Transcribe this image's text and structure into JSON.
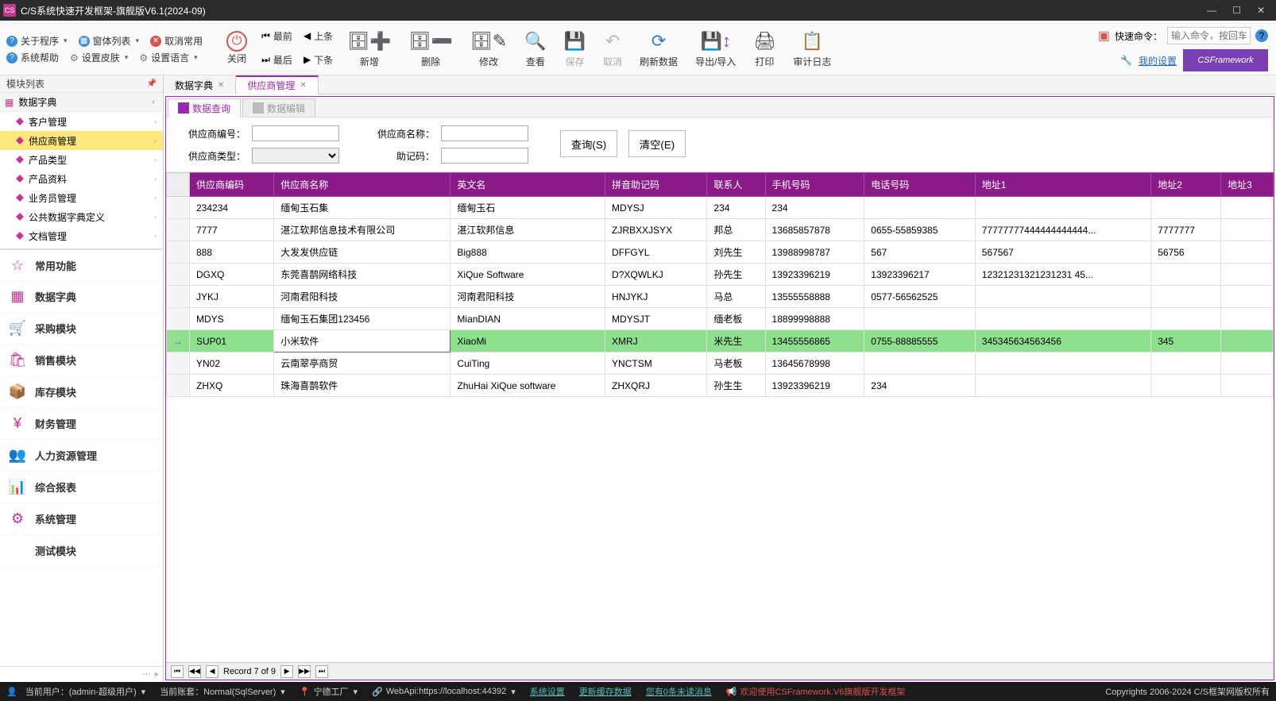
{
  "titlebar": {
    "title": "C/S系统快速开发框架-旗舰版V6.1(2024-09)"
  },
  "toolbar": {
    "about": "关于程序",
    "windowList": "窗体列表",
    "cancelCommon": "取消常用",
    "sysHelp": "系统帮助",
    "skin": "设置皮肤",
    "lang": "设置语言",
    "close": "关闭",
    "first": "最前",
    "prev": "上条",
    "last": "最后",
    "next": "下条",
    "add": "新增",
    "delete": "删除",
    "modify": "修改",
    "view": "查看",
    "save": "保存",
    "cancel": "取消",
    "refresh": "刷新数据",
    "importExport": "导出/导入",
    "print": "打印",
    "auditLog": "审计日志",
    "quickCmd": "快速命令：",
    "quickPlaceholder": "输入命令，按回车",
    "mySettings": "我的设置",
    "logoText": "CSFramework"
  },
  "sidebar": {
    "title": "模块列表",
    "treeRoot": "数据字典",
    "items": [
      "客户管理",
      "供应商管理",
      "产品类型",
      "产品资料",
      "业务员管理",
      "公共数据字典定义",
      "文档管理"
    ],
    "activeIndex": 1,
    "modules": [
      "常用功能",
      "数据字典",
      "采购模块",
      "销售模块",
      "库存模块",
      "财务管理",
      "人力资源管理",
      "综合报表",
      "系统管理",
      "测试模块"
    ]
  },
  "tabs": {
    "items": [
      "数据字典",
      "供应商管理"
    ],
    "active": 1
  },
  "subtabs": {
    "query": "数据查询",
    "edit": "数据编辑"
  },
  "form": {
    "supCode": "供应商编号：",
    "supName": "供应商名称：",
    "supType": "供应商类型：",
    "mnemonic": "助记码：",
    "search": "查询(S)",
    "clear": "清空(E)"
  },
  "grid": {
    "columns": [
      "供应商编码",
      "供应商名称",
      "英文名",
      "拼音助记码",
      "联系人",
      "手机号码",
      "电话号码",
      "地址1",
      "地址2",
      "地址3"
    ],
    "rows": [
      {
        "c": [
          "234234",
          "缅甸玉石集",
          "缅甸玉石",
          "MDYSJ",
          "234",
          "234",
          "",
          "",
          "",
          ""
        ]
      },
      {
        "c": [
          "7777",
          "湛江软邦信息技术有限公司",
          "湛江软邦信息",
          "ZJRBXXJSYX",
          "邦总",
          "13685857878",
          "0655-55859385",
          "77777777444444444444...",
          "7777777",
          ""
        ]
      },
      {
        "c": [
          "888",
          "大发发供应链",
          "Big888",
          "DFFGYL",
          "刘先生",
          "13988998787",
          "567",
          "567567",
          "56756",
          ""
        ]
      },
      {
        "c": [
          "DGXQ",
          "东莞喜鹊网络科技",
          "XiQue Software",
          "D?XQWLKJ",
          "孙先生",
          "13923396219",
          "13923396217",
          "12321231321231231 45...",
          "",
          ""
        ]
      },
      {
        "c": [
          "JYKJ",
          "河南君阳科技",
          "河南君阳科技",
          "HNJYKJ",
          "马总",
          "13555558888",
          "0577-56562525",
          "",
          "",
          ""
        ]
      },
      {
        "c": [
          "MDYS",
          "缅甸玉石集团123456",
          "MianDIAN",
          "MDYSJT",
          "缅老板",
          "18899998888",
          "",
          "",
          "",
          ""
        ]
      },
      {
        "c": [
          "SUP01",
          "小米软件",
          "XiaoMi",
          "XMRJ",
          "米先生",
          "13455556865",
          "0755-88885555",
          "345345634563456",
          "345",
          ""
        ],
        "selected": true
      },
      {
        "c": [
          "YN02",
          "云南翠亭商贸",
          "CuiTing",
          "YNCTSM",
          "马老板",
          "13645678998",
          "",
          "",
          "",
          ""
        ]
      },
      {
        "c": [
          "ZHXQ",
          "珠海喜鹊软件",
          "ZhuHai XiQue software",
          "ZHXQRJ",
          "孙生生",
          "13923396219",
          "234",
          "",
          "",
          ""
        ]
      }
    ],
    "recordText": "Record 7 of 9"
  },
  "statusbar": {
    "user": "当前用户：(admin-超级用户)",
    "account": "当前账套：Normal(SqlServer)",
    "factory": "宁德工厂",
    "webapi": "WebApi:https://localhost:44392",
    "sysSettings": "系统设置",
    "updateCache": "更新缓存数据",
    "unread": "您有0条未读消息",
    "welcome": "欢迎使用CSFramework.V6旗舰版开发框架",
    "copyright": "Copyrights 2006-2024 C/S框架网版权所有"
  }
}
